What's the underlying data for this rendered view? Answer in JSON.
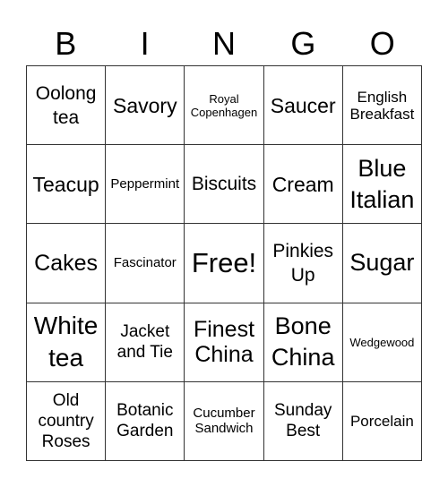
{
  "header": [
    "B",
    "I",
    "N",
    "G",
    "O"
  ],
  "cells": [
    "Oolong\ntea",
    "Savory",
    "Royal\nCopenhagen",
    "Saucer",
    "English\nBreakfast",
    "Teacup",
    "Peppermint",
    "Biscuits",
    "Cream",
    "Blue\nItalian",
    "Cakes",
    "Fascinator",
    "Free!",
    "Pinkies\nUp",
    "Sugar",
    "White\ntea",
    "Jacket\nand Tie",
    "Finest\nChina",
    "Bone\nChina",
    "Wedgewood",
    "Old\ncountry\nRoses",
    "Botanic\nGarden",
    "Cucumber\nSandwich",
    "Sunday\nBest",
    "Porcelain"
  ]
}
